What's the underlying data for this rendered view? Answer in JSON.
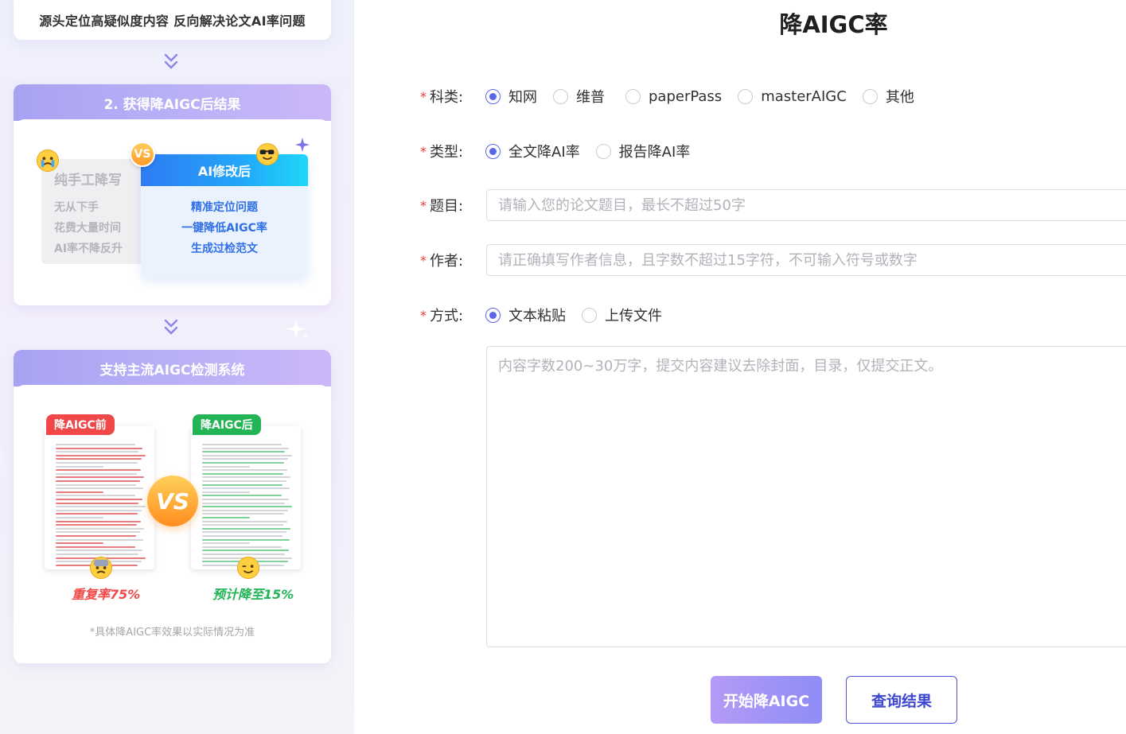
{
  "left_panel": {
    "top_card_text": "源头定位高疑似度内容 反向解决论文AI率问题",
    "step2": {
      "title": "2. 获得降AIGC后结果",
      "manual": {
        "title": "纯手工降写",
        "lines": [
          "无从下手",
          "花费大量时间",
          "AI率不降反升"
        ]
      },
      "vs": "VS",
      "ai": {
        "title": "AI修改后",
        "lines": [
          "精准定位问题",
          "一键降低AIGC率",
          "生成过检范文"
        ]
      }
    },
    "systems": {
      "title": "支持主流AIGC检测系统",
      "before_tag": "降AIGC前",
      "after_tag": "降AIGC后",
      "vs": "VS",
      "before_rate": "重复率75%",
      "after_rate": "预计降至15%",
      "note": "*具体降AIGC率效果以实际情况为准"
    }
  },
  "form": {
    "title": "降AIGC率",
    "subject": {
      "label": "科类:",
      "options": [
        "知网",
        "维普",
        "paperPass",
        "masterAIGC",
        "其他"
      ],
      "selected": "知网"
    },
    "type": {
      "label": "类型:",
      "options": [
        "全文降AI率",
        "报告降AI率"
      ],
      "selected": "全文降AI率"
    },
    "topic": {
      "label": "题目:",
      "placeholder": "请输入您的论文题目，最长不超过50字"
    },
    "author": {
      "label": "作者:",
      "placeholder": "请正确填写作者信息，且字数不超过15字符，不可输入符号或数字"
    },
    "method": {
      "label": "方式:",
      "options": [
        "文本粘贴",
        "上传文件"
      ],
      "selected": "文本粘贴"
    },
    "content": {
      "placeholder": "内容字数200~30万字，提交内容建议去除封面，目录，仅提交正文。"
    },
    "buttons": {
      "start": "开始降AIGC",
      "query": "查询结果"
    }
  },
  "colors": {
    "accent": "#5b67e9",
    "required": "#f23a3a",
    "before_red": "#f04848",
    "after_green": "#22b455"
  }
}
